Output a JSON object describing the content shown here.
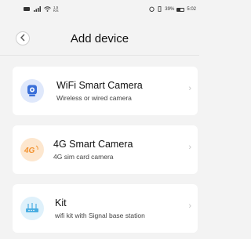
{
  "status_bar": {
    "signal_text": "1.5\nK/s",
    "battery_text": "39%",
    "time": "5:02"
  },
  "header": {
    "title": "Add device",
    "back_icon": "chevron-left-icon"
  },
  "devices": [
    {
      "title": "WiFi Smart Camera",
      "subtitle": "Wireless or wired camera",
      "icon": "camera-icon",
      "icon_color": "#3a6fd8"
    },
    {
      "title": "4G Smart Camera",
      "subtitle": "4G sim card camera",
      "icon": "4g-icon",
      "icon_color": "#f2922f"
    },
    {
      "title": "Kit",
      "subtitle": "wifi kit with Signal base station",
      "icon": "router-icon",
      "icon_color": "#4aaee2"
    }
  ],
  "chevron": "›"
}
